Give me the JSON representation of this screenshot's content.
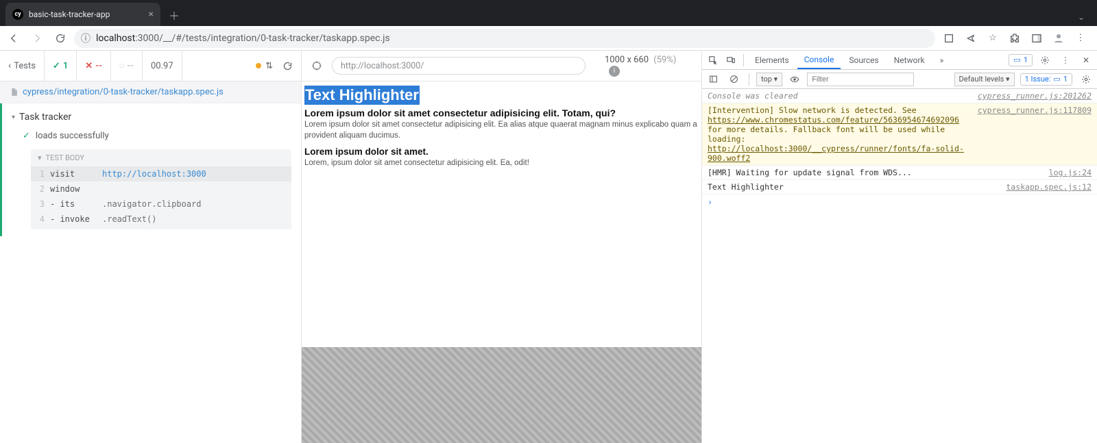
{
  "browser": {
    "tab_title": "basic-task-tracker-app",
    "url_host": "localhost",
    "url_rest": ":3000/__/#/tests/integration/0-task-tracker/taskapp.spec.js"
  },
  "reporter": {
    "back_label": "Tests",
    "passed": "1",
    "failed": "--",
    "pending": "--",
    "duration": "00.97",
    "spec_path": "cypress/integration/0-task-tracker/taskapp.spec.js",
    "suite": "Task tracker",
    "test": "loads successfully",
    "section_label": "TEST BODY",
    "commands": [
      {
        "n": "1",
        "name": "visit",
        "arg": "http://localhost:3000",
        "arg_class": "cmd-arg",
        "active": true
      },
      {
        "n": "2",
        "name": "window",
        "arg": "",
        "arg_class": "cmd-arg gray",
        "active": false
      },
      {
        "n": "3",
        "name": "- its",
        "arg": ".navigator.clipboard",
        "arg_class": "cmd-arg gray",
        "active": false
      },
      {
        "n": "4",
        "name": "- invoke",
        "arg": ".readText()",
        "arg_class": "cmd-arg gray",
        "active": false
      }
    ]
  },
  "aut": {
    "url": "http://localhost:3000/",
    "viewport": "1000 x 660",
    "scale": "(59%)",
    "highlight_title": "Text Highlighter",
    "para1_bold": "Lorem ipsum dolor sit amet consectetur adipisicing elit. Totam, qui?",
    "para1": "Lorem ipsum dolor sit amet consectetur adipisicing elit. Ea alias atque quaerat magnam minus explicabo quam a provident aliquam ducimus.",
    "para2_bold": "Lorem ipsum dolor sit amet.",
    "para2": "Lorem, ipsum dolor sit amet consectetur adipisicing elit. Ea, odit!"
  },
  "devtools": {
    "tabs": {
      "elements": "Elements",
      "console": "Console",
      "sources": "Sources",
      "network": "Network"
    },
    "msg_badge": "1",
    "context": "top ▾",
    "filter_placeholder": "Filter",
    "levels": "Default levels ▾",
    "issues_label": "1 Issue:",
    "issues_count": "1",
    "log": {
      "cleared": "Console was cleared",
      "cleared_src": "cypress_runner.js:201262",
      "warn_pre": "[Intervention] Slow network is detected. See ",
      "warn_link1": "https://www.chromestatus.com/feature/5636954674692096",
      "warn_mid": " for more details. Fallback font will be used while loading: ",
      "warn_link2": "http://localhost:3000/__cypress/runner/fonts/fa-solid-900.woff2",
      "warn_src": "cypress_runner.js:117809",
      "hmr": "[HMR] Waiting for update signal from WDS...",
      "hmr_src": "log.js:24",
      "app": "Text Highlighter",
      "app_src": "taskapp.spec.js:12"
    }
  }
}
